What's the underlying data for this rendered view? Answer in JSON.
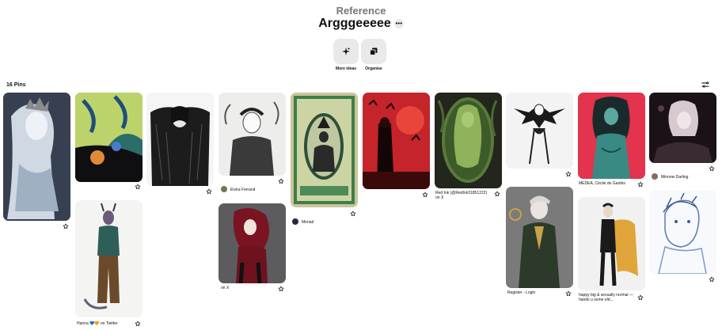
{
  "header": {
    "breadcrumb": "Reference",
    "title": "Argggeeeee",
    "more_label": "•••"
  },
  "actions": {
    "more_ideas": "More ideas",
    "organise": "Organise"
  },
  "pin_count": "16 Pins",
  "pins": {
    "elvira": "Elvira Ferrand",
    "meriad": "Meriad",
    "redink": "Red Ink (@RedInk31851222) on X",
    "medea": "MEDEA, Cécile de Gantès",
    "minnow": "Minnow Darling",
    "hanna": "Hanna 💙🧡 on Twitter",
    "onx": "on X",
    "register": "Register - Login",
    "happy": "happy big & sexually normal — hands u some old..."
  },
  "icons": {
    "star": "star-outline-icon",
    "sparkle": "sparkle-icon",
    "organise": "organise-icon",
    "filter": "filter-icon"
  }
}
